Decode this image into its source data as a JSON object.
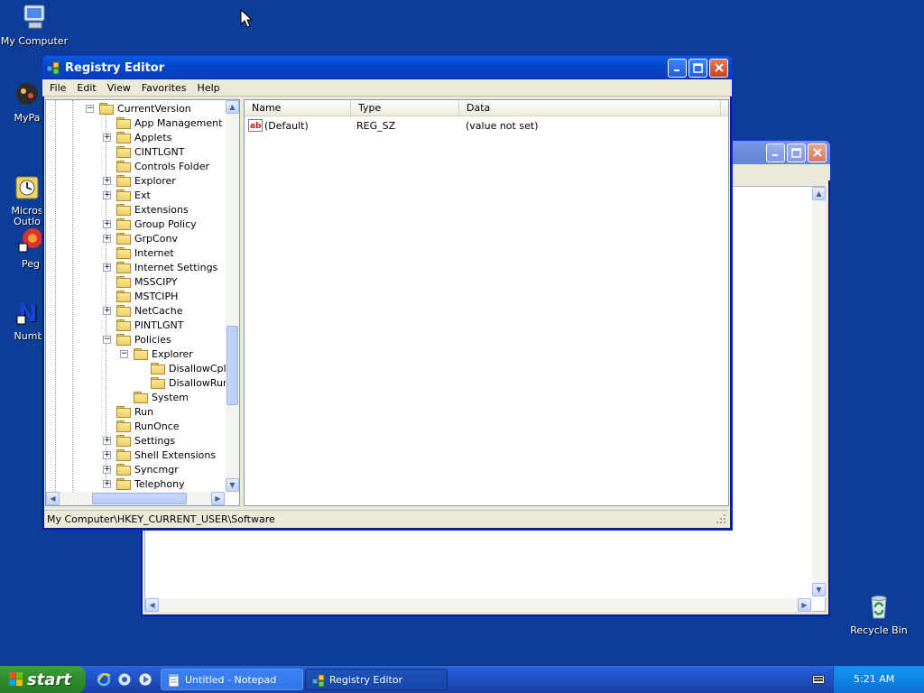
{
  "desktop": {
    "icons": [
      {
        "label": "My Computer"
      },
      {
        "label": "MyPa"
      },
      {
        "label": "Micros\nOutlo"
      },
      {
        "label": "Peg"
      },
      {
        "label": "Numb"
      },
      {
        "label": "Recycle Bin"
      }
    ]
  },
  "notepad_window": {
    "title": ""
  },
  "registry": {
    "title": "Registry Editor",
    "menu": [
      "File",
      "Edit",
      "View",
      "Favorites",
      "Help"
    ],
    "tree": [
      {
        "label": "CurrentVersion",
        "level": 0,
        "toggle": "minus"
      },
      {
        "label": "App Management",
        "level": 1,
        "toggle": ""
      },
      {
        "label": "Applets",
        "level": 1,
        "toggle": "plus"
      },
      {
        "label": "CINTLGNT",
        "level": 1,
        "toggle": ""
      },
      {
        "label": "Controls Folder",
        "level": 1,
        "toggle": ""
      },
      {
        "label": "Explorer",
        "level": 1,
        "toggle": "plus"
      },
      {
        "label": "Ext",
        "level": 1,
        "toggle": "plus"
      },
      {
        "label": "Extensions",
        "level": 1,
        "toggle": ""
      },
      {
        "label": "Group Policy",
        "level": 1,
        "toggle": "plus"
      },
      {
        "label": "GrpConv",
        "level": 1,
        "toggle": "plus"
      },
      {
        "label": "Internet",
        "level": 1,
        "toggle": ""
      },
      {
        "label": "Internet Settings",
        "level": 1,
        "toggle": "plus"
      },
      {
        "label": "MSSCIPY",
        "level": 1,
        "toggle": ""
      },
      {
        "label": "MSTCIPH",
        "level": 1,
        "toggle": ""
      },
      {
        "label": "NetCache",
        "level": 1,
        "toggle": "plus"
      },
      {
        "label": "PINTLGNT",
        "level": 1,
        "toggle": ""
      },
      {
        "label": "Policies",
        "level": 1,
        "toggle": "minus"
      },
      {
        "label": "Explorer",
        "level": 2,
        "toggle": "minus"
      },
      {
        "label": "DisallowCpl",
        "level": 3,
        "toggle": ""
      },
      {
        "label": "DisallowRun",
        "level": 3,
        "toggle": ""
      },
      {
        "label": "System",
        "level": 2,
        "toggle": ""
      },
      {
        "label": "Run",
        "level": 1,
        "toggle": ""
      },
      {
        "label": "RunOnce",
        "level": 1,
        "toggle": ""
      },
      {
        "label": "Settings",
        "level": 1,
        "toggle": "plus"
      },
      {
        "label": "Shell Extensions",
        "level": 1,
        "toggle": "plus"
      },
      {
        "label": "Syncmgr",
        "level": 1,
        "toggle": "plus"
      },
      {
        "label": "Telephony",
        "level": 1,
        "toggle": "plus"
      }
    ],
    "columns": [
      "Name",
      "Type",
      "Data"
    ],
    "values": [
      {
        "name": "(Default)",
        "type": "REG_SZ",
        "data": "(value not set)",
        "icon": "ab-string-icon"
      }
    ],
    "status": "My Computer\\HKEY_CURRENT_USER\\Software"
  },
  "taskbar": {
    "start_label": "start",
    "tasks": [
      {
        "label": "Untitled - Notepad",
        "active": false,
        "icon": "notepad-icon"
      },
      {
        "label": "Registry Editor",
        "active": true,
        "icon": "regedit-icon"
      }
    ],
    "clock": "5:21 AM"
  },
  "colors": {
    "desktop": "#0c3d99",
    "titlebar": "#0a3fbd",
    "taskbar": "#245edb",
    "start": "#2e8b2c"
  }
}
